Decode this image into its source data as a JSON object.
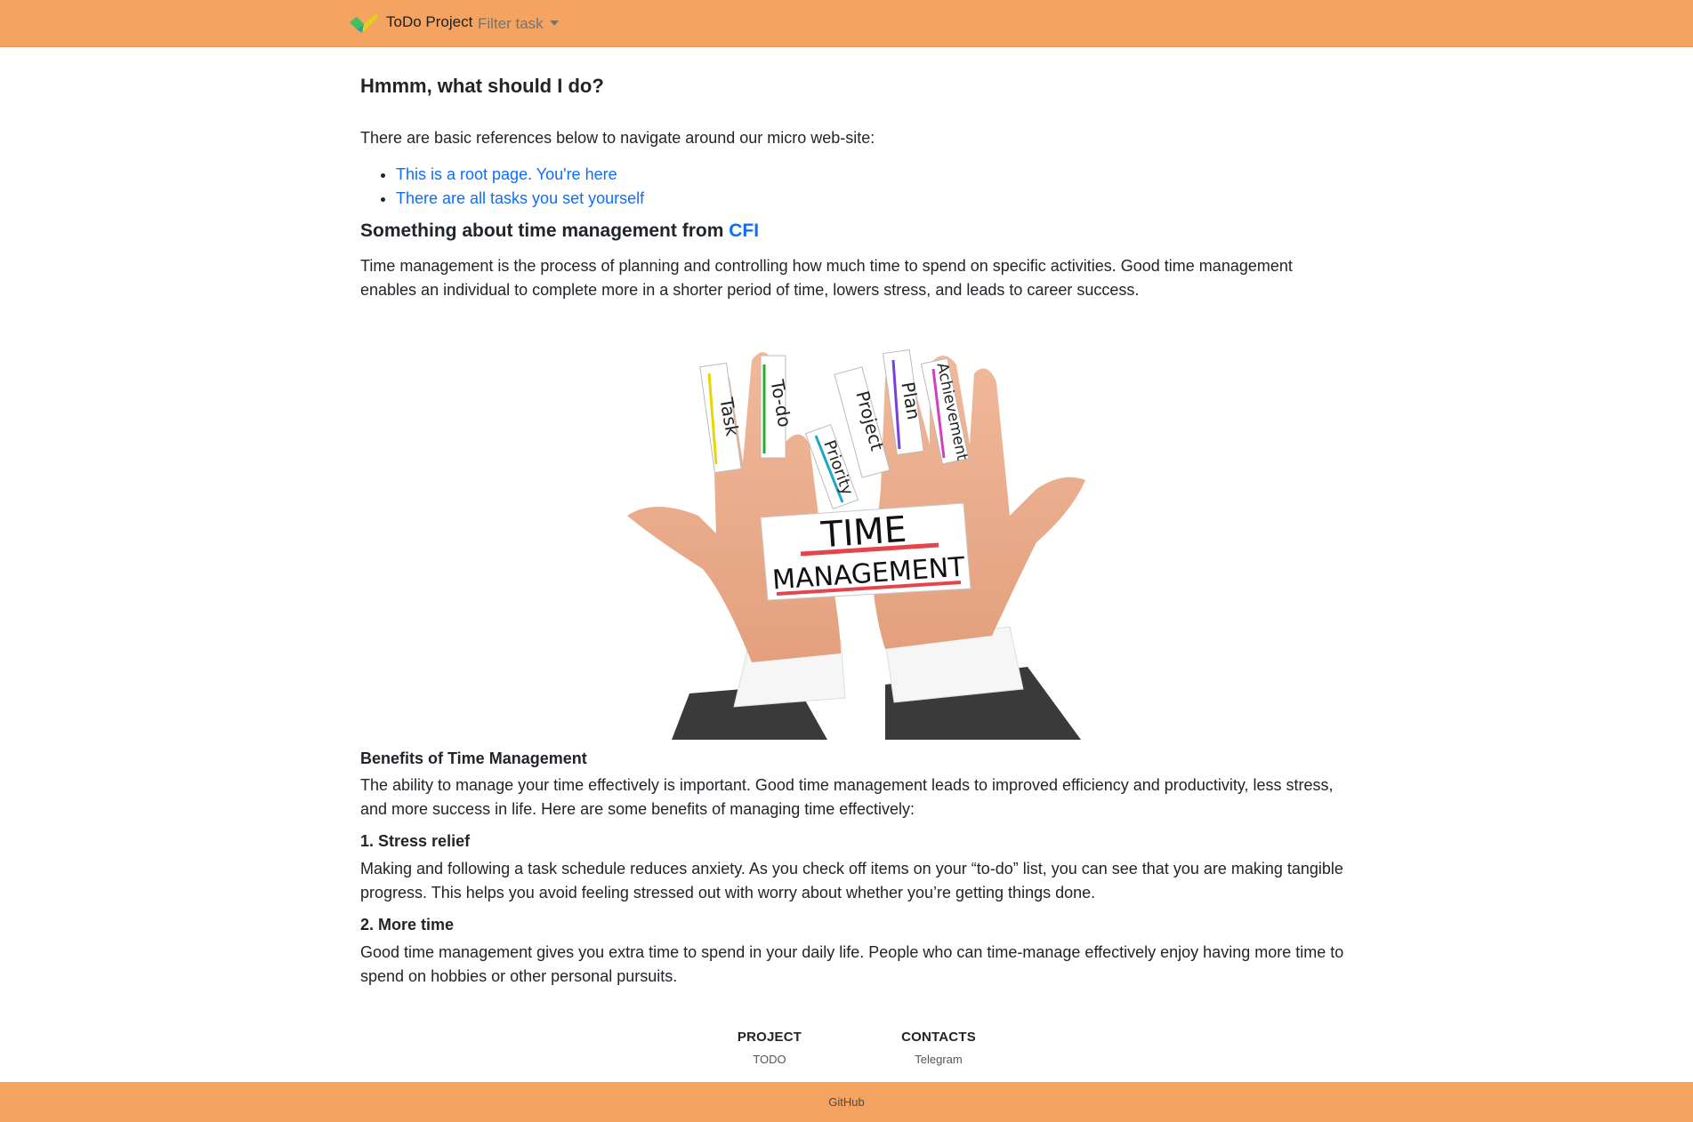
{
  "navbar": {
    "brand_name": "ToDo Project",
    "brand_icon": "checkmark-logo-icon",
    "filter_label": "Filter task",
    "background": "#f4a460"
  },
  "main": {
    "title": "Hmmm, what should I do?",
    "intro": "There are basic references below to navigate around our micro web-site:",
    "links": [
      "This is a root page. You're here",
      "There are all tasks you set yourself"
    ],
    "section_title": "Something about time management from",
    "section_source": "CFI",
    "definition": "Time management is the process of planning and controlling how much time to spend on specific activities. Good time management enables an individual to complete more in a shorter period of time, lowers stress, and leads to career success.",
    "image": {
      "finger_labels": [
        "Task",
        "To-do",
        "Priority",
        "Project",
        "Plan",
        "Achievement"
      ],
      "palm_label_top": "TIME",
      "palm_label_bottom": "MANAGEMENT"
    },
    "benefits_title": "Benefits of Time Management",
    "benefits_intro": "The ability to manage your time effectively is important. Good time management leads to improved efficiency and productivity, less stress, and more success in life. Here are some benefits of managing time effectively:",
    "items": [
      {
        "title": "1. Stress relief",
        "text": "Making and following a task schedule reduces anxiety. As you check off items on your “to-do” list, you can see that you are making tangible progress. This helps you avoid feeling stressed out with worry about whether you’re getting things done."
      },
      {
        "title": "2. More time",
        "text": "Good time management gives you extra time to spend in your daily life. People who can time-manage effectively enjoy having more time to spend on hobbies or other personal pursuits."
      }
    ]
  },
  "footer": {
    "columns": [
      {
        "heading": "PROJECT",
        "link": "TODO"
      },
      {
        "heading": "CONTACTS",
        "link": "Telegram"
      }
    ],
    "bottom_link": "GitHub",
    "background": "#f4a460"
  },
  "colors": {
    "link": "#0d6efd",
    "text": "#212529",
    "muted": "#6c757d"
  }
}
